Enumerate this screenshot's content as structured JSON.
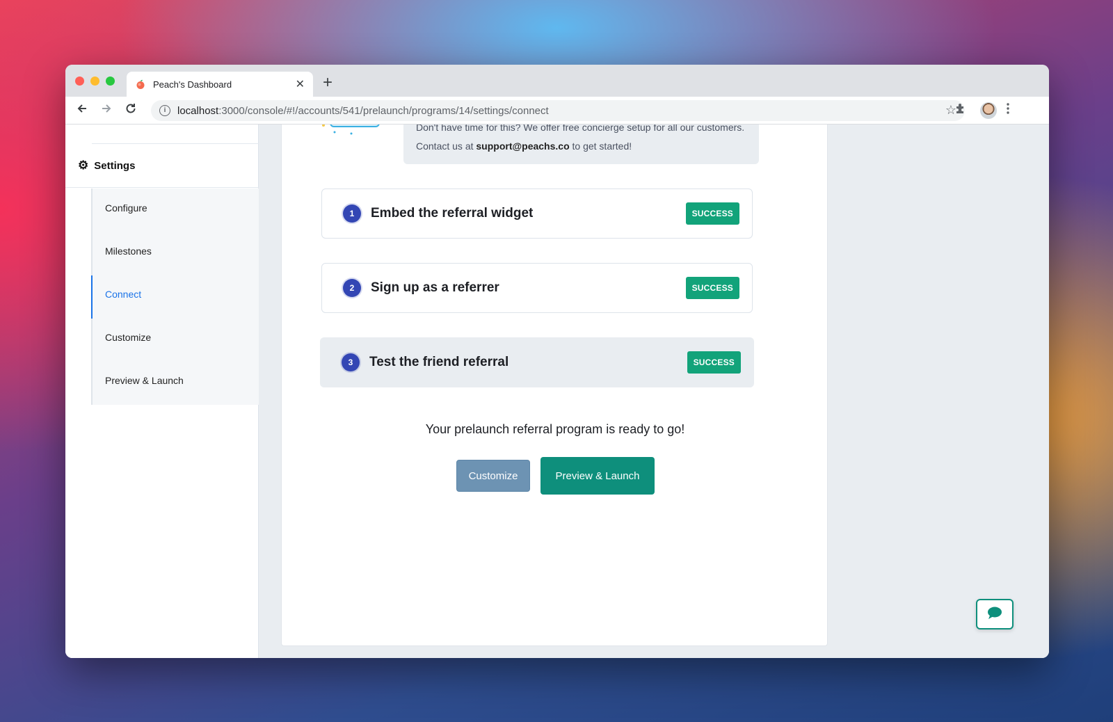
{
  "browser": {
    "tab_title": "Peach's Dashboard",
    "tab_close": "✕",
    "new_tab": "+",
    "url_host": "localhost",
    "url_path": ":3000/console/#!/accounts/541/prelaunch/programs/14/settings/connect"
  },
  "sidebar": {
    "section_title": "Settings",
    "items": [
      {
        "label": "Configure"
      },
      {
        "label": "Milestones"
      },
      {
        "label": "Connect"
      },
      {
        "label": "Customize"
      },
      {
        "label": "Preview & Launch"
      }
    ],
    "active_item": "Connect"
  },
  "concierge": {
    "text_before": "Don't have time for this? We offer free concierge setup for all our customers. Contact us at ",
    "email": "support@peachs.co",
    "text_after": " to get started!"
  },
  "steps": [
    {
      "number": "1",
      "title": "Embed the referral widget",
      "status": "SUCCESS"
    },
    {
      "number": "2",
      "title": "Sign up as a referrer",
      "status": "SUCCESS"
    },
    {
      "number": "3",
      "title": "Test the friend referral",
      "status": "SUCCESS"
    }
  ],
  "ready_message": "Your prelaunch referral program is ready to go!",
  "actions": {
    "customize_label": "Customize",
    "launch_label": "Preview & Launch"
  },
  "colors": {
    "accent": "#0e8f7c",
    "success": "#12a37a",
    "step_number": "#3346b4",
    "active_link": "#1a73e8"
  },
  "icons": [
    "peach-favicon",
    "back-arrow-icon",
    "forward-arrow-icon",
    "reload-icon",
    "info-icon",
    "star-icon",
    "extensions-icon",
    "more-menu-icon",
    "gear-icon",
    "chat-icon"
  ]
}
